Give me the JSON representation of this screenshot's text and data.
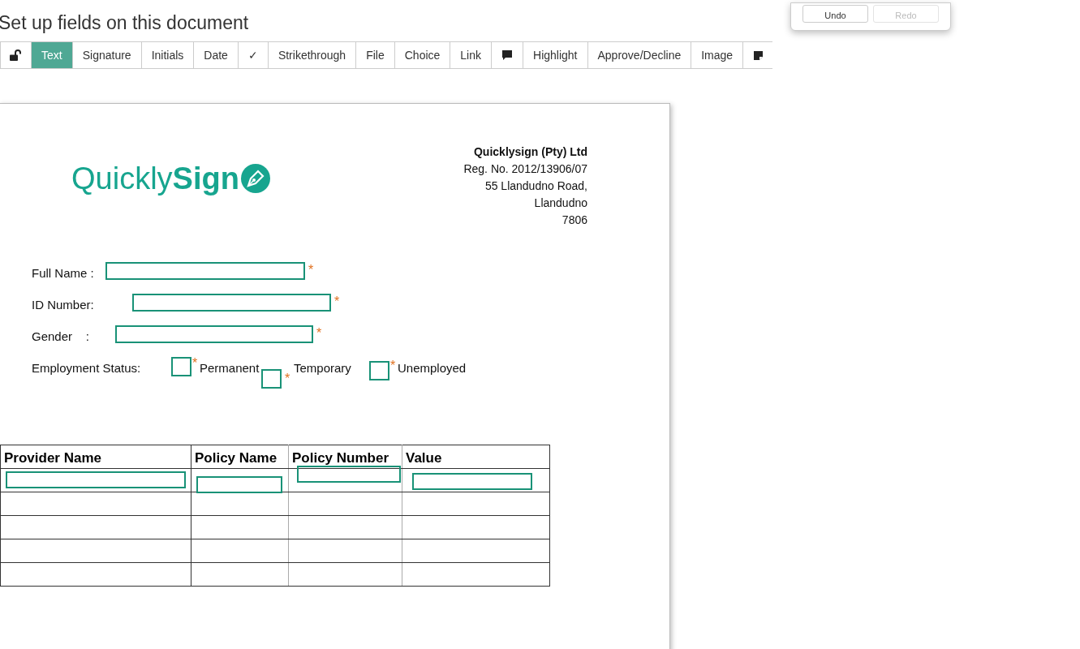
{
  "title": "Set up fields on this document",
  "history": [
    {
      "label": "Undo",
      "disabled": false
    },
    {
      "label": "Redo",
      "disabled": true
    }
  ],
  "tools": [
    {
      "kind": "lock",
      "selected": false
    },
    {
      "kind": "label",
      "label": "Text",
      "selected": true
    },
    {
      "kind": "label",
      "label": "Signature",
      "selected": false
    },
    {
      "kind": "label",
      "label": "Initials",
      "selected": false
    },
    {
      "kind": "label",
      "label": "Date",
      "selected": false
    },
    {
      "kind": "label",
      "label": "✓",
      "selected": false
    },
    {
      "kind": "label",
      "label": "Strikethrough",
      "selected": false
    },
    {
      "kind": "label",
      "label": "File",
      "selected": false
    },
    {
      "kind": "label",
      "label": "Choice",
      "selected": false
    },
    {
      "kind": "label",
      "label": "Link",
      "selected": false
    },
    {
      "kind": "comment",
      "selected": false
    },
    {
      "kind": "label",
      "label": "Highlight",
      "selected": false
    },
    {
      "kind": "label",
      "label": "Approve/Decline",
      "selected": false
    },
    {
      "kind": "label",
      "label": "Image",
      "selected": false
    },
    {
      "kind": "note",
      "selected": false
    }
  ],
  "document": {
    "logo": {
      "light": "Quickly",
      "bold": "Sign"
    },
    "company": [
      "Quicklysign (Pty) Ltd",
      "Reg. No. 2012/13906/07",
      "55 Llandudno Road,",
      "Llandudno",
      "7806"
    ],
    "form": [
      {
        "label": "Full Name :",
        "required_mark": "*"
      },
      {
        "label": "ID Number:",
        "required_mark": "*"
      },
      {
        "label": "Gender    :",
        "required_mark": "*"
      }
    ],
    "employment": {
      "label": "Employment Status:",
      "options": [
        {
          "label": "Permanent",
          "required_mark": "*"
        },
        {
          "label": "Temporary",
          "required_mark": "*"
        },
        {
          "label": "Unemployed",
          "required_mark": "*"
        }
      ]
    },
    "table": {
      "columns": [
        "Provider Name",
        "Policy Name",
        "Policy Number",
        "Value"
      ],
      "rows": [
        {
          "kind": "fields"
        },
        {
          "kind": "blank"
        },
        {
          "kind": "blank"
        },
        {
          "kind": "blank"
        },
        {
          "kind": "blank"
        }
      ]
    }
  }
}
